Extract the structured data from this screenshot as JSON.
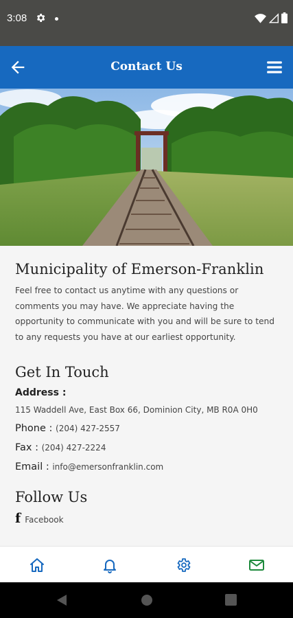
{
  "status_bar": {
    "time": "3:08",
    "icons": [
      "gear-icon",
      "notification-dot",
      "wifi-icon",
      "signal-icon",
      "battery-icon"
    ]
  },
  "app_bar": {
    "title": "Contact Us",
    "color": "#1769bf",
    "icons": [
      "back-arrow-icon",
      "hamburger-menu-icon"
    ]
  },
  "content": {
    "org_name": "Municipality of Emerson-Franklin",
    "intro": "Feel free to contact us anytime with any questions or comments you may have. We appreciate having the opportunity to communicate with you and will be sure to tend to any requests you have at our earliest opportunity.",
    "get_in_touch": {
      "title": "Get In Touch",
      "address_label": "Address :",
      "address": "115 Waddell Ave, East Box 66, Dominion City, MB R0A 0H0",
      "phone_label": "Phone :",
      "phone": "(204) 427-2557",
      "fax_label": "Fax :",
      "fax": "(204) 427-2224",
      "email_label": "Email :",
      "email": "info@emersonfranklin.com"
    },
    "follow_us": {
      "title": "Follow Us",
      "facebook_icon": "f",
      "facebook": "Facebook"
    }
  },
  "bottom_nav": {
    "items": [
      "home-icon",
      "bell-icon",
      "settings-icon",
      "mail-icon"
    ],
    "accent": "#1769bf",
    "active_color": "#1e8a3c"
  }
}
